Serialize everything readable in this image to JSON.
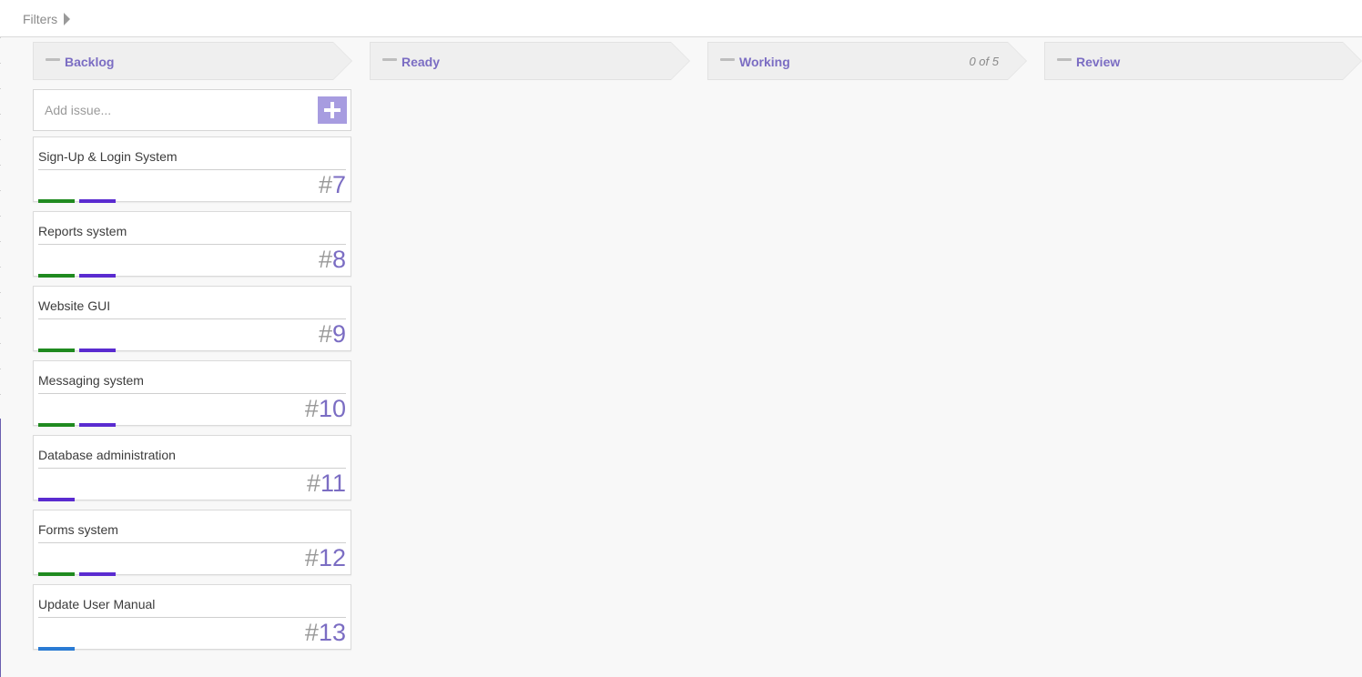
{
  "topbar": {
    "filters_label": "Filters"
  },
  "columns": [
    {
      "title": "Backlog",
      "wip": ""
    },
    {
      "title": "Ready",
      "wip": ""
    },
    {
      "title": "Working",
      "wip": "0 of 5"
    },
    {
      "title": "Review",
      "wip": ""
    }
  ],
  "add_issue": {
    "placeholder": "Add issue..."
  },
  "tag_colors": {
    "green": "#1f8a1f",
    "purple": "#5a2bd0",
    "blue": "#2a7bd4"
  },
  "cards": [
    {
      "title": "Sign-Up & Login System",
      "number": "7",
      "tags": [
        "green",
        "purple"
      ]
    },
    {
      "title": "Reports system",
      "number": "8",
      "tags": [
        "green",
        "purple"
      ]
    },
    {
      "title": "Website GUI",
      "number": "9",
      "tags": [
        "green",
        "purple"
      ]
    },
    {
      "title": "Messaging system",
      "number": "10",
      "tags": [
        "green",
        "purple"
      ]
    },
    {
      "title": "Database administration",
      "number": "11",
      "tags": [
        "purple"
      ]
    },
    {
      "title": "Forms system",
      "number": "12",
      "tags": [
        "green",
        "purple"
      ]
    },
    {
      "title": "Update User Manual",
      "number": "13",
      "tags": [
        "blue"
      ]
    }
  ]
}
